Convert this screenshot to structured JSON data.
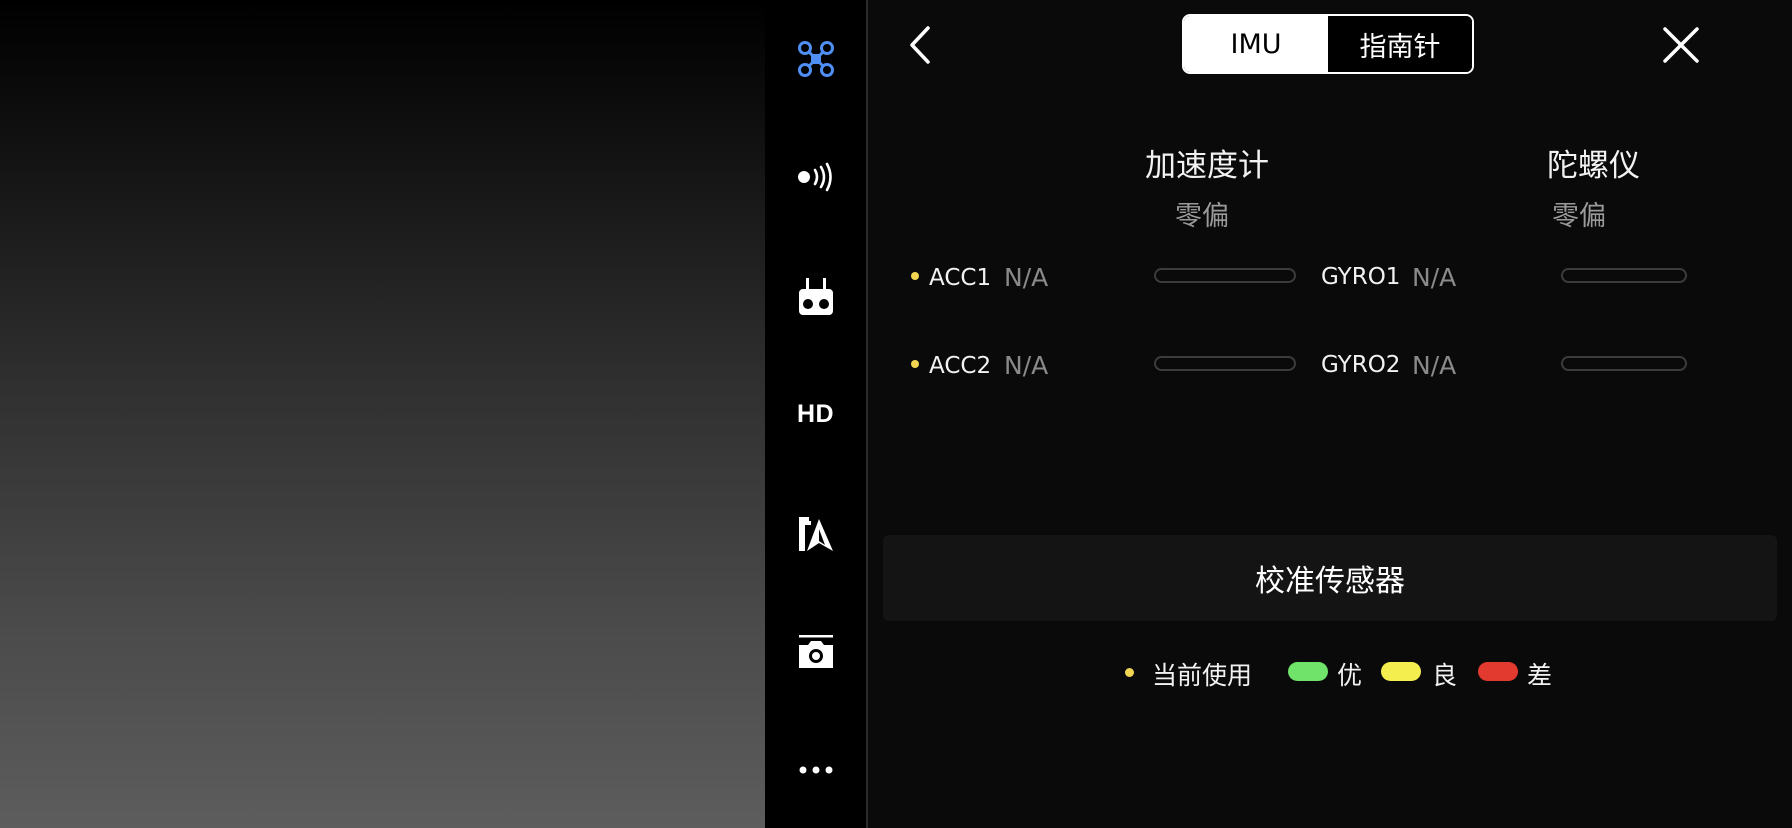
{
  "sidebar": {
    "items": [
      {
        "name": "aircraft-icon",
        "active": true
      },
      {
        "name": "signal-icon"
      },
      {
        "name": "remote-controller-icon"
      },
      {
        "name": "hd-transmission",
        "label": "HD"
      },
      {
        "name": "battery-navigation-icon"
      },
      {
        "name": "camera-icon"
      },
      {
        "name": "more-icon"
      }
    ]
  },
  "header": {
    "tabs": [
      {
        "label": "IMU",
        "active": true
      },
      {
        "label": "指南针",
        "active": false
      }
    ]
  },
  "columns": {
    "accelerometer": {
      "title": "加速度计",
      "subtitle": "零偏"
    },
    "gyroscope": {
      "title": "陀螺仪",
      "subtitle": "零偏"
    }
  },
  "rows": [
    {
      "acc_name": "ACC1",
      "acc_value": "N/A",
      "gyro_name": "GYRO1",
      "gyro_value": "N/A",
      "in_use": true
    },
    {
      "acc_name": "ACC2",
      "acc_value": "N/A",
      "gyro_name": "GYRO2",
      "gyro_value": "N/A",
      "in_use": true
    }
  ],
  "actions": {
    "calibrate_label": "校准传感器"
  },
  "legend": {
    "in_use_label": "当前使用",
    "excellent_label": "优",
    "good_label": "良",
    "poor_label": "差"
  },
  "colors": {
    "in_use": "#f2d653",
    "excellent": "#6fe36a",
    "good": "#f5ee4f",
    "poor": "#e23a2e",
    "active_icon": "#4f8ef5"
  }
}
